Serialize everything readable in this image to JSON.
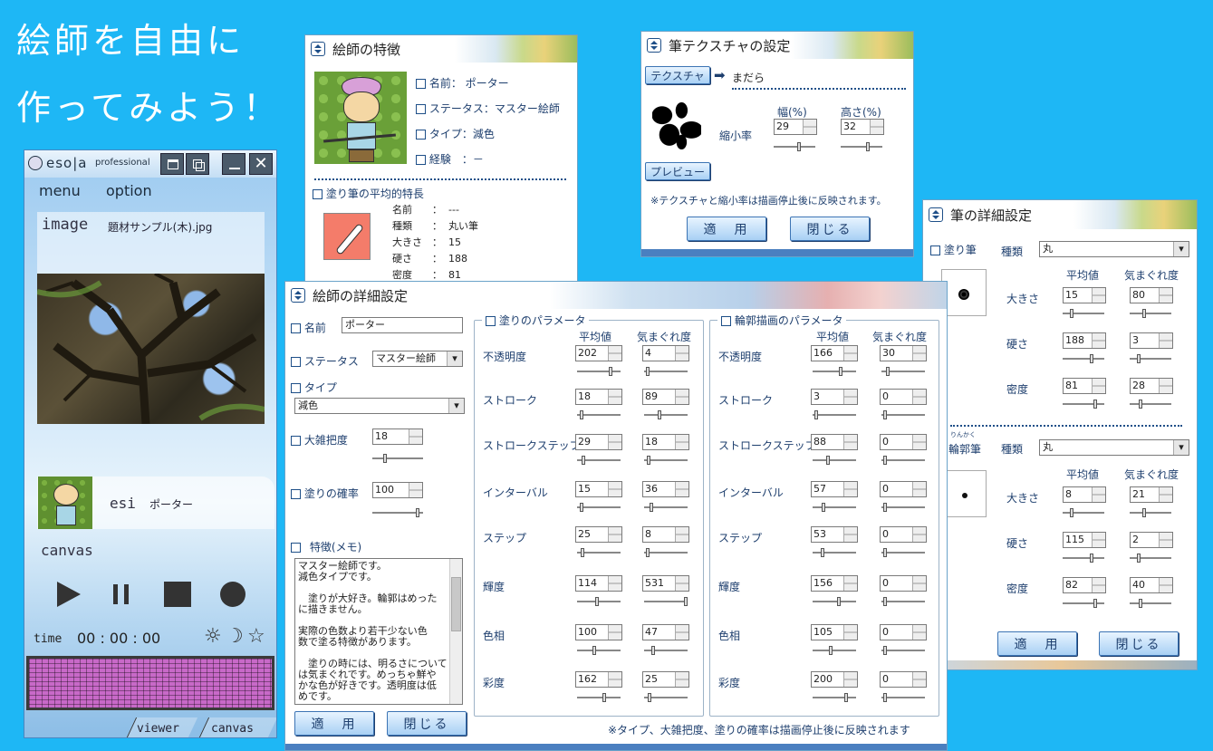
{
  "headline": {
    "line1": "絵師を自由に",
    "line2": "作ってみよう！"
  },
  "esola": {
    "logo": "eso|a",
    "edition": "professional",
    "menu": [
      "menu",
      "option"
    ],
    "image_label": "image",
    "image_file": "題材サンプル(木).jpg",
    "esi_label": "esi",
    "esi_name": "ポーター",
    "canvas_label": "canvas",
    "time_label": "time",
    "time_value": "00 : 00 : 00",
    "tabs": [
      "viewer",
      "canvas"
    ],
    "level_percent": 100
  },
  "features": {
    "title": "絵師の特徴",
    "name": "名前： ポーター",
    "status": "ステータス：マスター絵師",
    "type": "タイプ：減色",
    "experience": "経験　：－",
    "brush_section": "塗り筆の平均的特長",
    "brush_rows": [
      {
        "k": "名前",
        "v": "---"
      },
      {
        "k": "種類",
        "v": "丸い筆"
      },
      {
        "k": "大きさ",
        "v": "15"
      },
      {
        "k": "硬さ",
        "v": "188"
      },
      {
        "k": "密度",
        "v": "81"
      }
    ]
  },
  "texture": {
    "title": "筆テクスチャの設定",
    "texture_button": "テクスチャ",
    "texture_name": "まだら",
    "width_label": "幅(%)",
    "height_label": "高さ(%)",
    "scale_label": "縮小率",
    "width_value": "29",
    "height_value": "32",
    "preview_button": "プレビュー",
    "note": "※テクスチャと縮小率は描画停止後に反映されます。",
    "apply": "適　用",
    "close": "閉じる"
  },
  "brush_detail": {
    "title": "筆の詳細設定",
    "paint_label": "塗り筆",
    "kind_label": "種類",
    "paint_kind": "丸",
    "avg_label": "平均値",
    "var_label": "気まぐれ度",
    "paint_rows": [
      {
        "label": "大きさ",
        "avg": "15",
        "var": "80"
      },
      {
        "label": "硬さ",
        "avg": "188",
        "var": "3"
      },
      {
        "label": "密度",
        "avg": "81",
        "var": "28"
      }
    ],
    "ruby": "りんかく",
    "outline_label": "輪郭筆",
    "outline_kind": "丸",
    "outline_rows": [
      {
        "label": "大きさ",
        "avg": "8",
        "var": "21"
      },
      {
        "label": "硬さ",
        "avg": "115",
        "var": "2"
      },
      {
        "label": "密度",
        "avg": "82",
        "var": "40"
      }
    ],
    "apply": "適　用",
    "close": "閉じる"
  },
  "detail": {
    "title": "絵師の詳細設定",
    "name_label": "名前",
    "name_value": "ポーター",
    "status_label": "ステータス",
    "status_value": "マスター絵師",
    "type_label": "タイプ",
    "type_value": "減色",
    "roughness_label": "大雑把度",
    "roughness_value": "18",
    "paint_prob_label": "塗りの確率",
    "paint_prob_value": "100",
    "memo_label": "特徴(メモ)",
    "memo_lines": [
      "マスター絵師です。",
      "減色タイプです。",
      "",
      "　塗りが大好き。輪郭はめった",
      "に描きません。",
      "",
      "実際の色数より若干少ない色",
      "数で塗る特徴があります。",
      "",
      "　塗りの時には、明るさについて",
      "は気まぐれです。めっちゃ鮮や",
      "かな色が好きです。透明度は低",
      "めです。"
    ],
    "paint_params_title": "塗りのパラメータ",
    "outline_params_title": "輪郭描画のパラメータ",
    "avg_label": "平均値",
    "var_label": "気まぐれ度",
    "paint_params": [
      {
        "label": "不透明度",
        "avg": "202",
        "var": "4"
      },
      {
        "label": "ストローク",
        "avg": "18",
        "var": "89"
      },
      {
        "label": "ストロークステップ",
        "avg": "29",
        "var": "18"
      },
      {
        "label": "インターバル",
        "avg": "15",
        "var": "36"
      },
      {
        "label": "ステップ",
        "avg": "25",
        "var": "8"
      },
      {
        "label": "輝度",
        "avg": "114",
        "var": "531"
      },
      {
        "label": "色相",
        "avg": "100",
        "var": "47"
      },
      {
        "label": "彩度",
        "avg": "162",
        "var": "25"
      }
    ],
    "outline_params": [
      {
        "label": "不透明度",
        "avg": "166",
        "var": "30"
      },
      {
        "label": "ストローク",
        "avg": "3",
        "var": "0"
      },
      {
        "label": "ストロークステップ",
        "avg": "88",
        "var": "0"
      },
      {
        "label": "インターバル",
        "avg": "57",
        "var": "0"
      },
      {
        "label": "ステップ",
        "avg": "53",
        "var": "0"
      },
      {
        "label": "輝度",
        "avg": "156",
        "var": "0"
      },
      {
        "label": "色相",
        "avg": "105",
        "var": "0"
      },
      {
        "label": "彩度",
        "avg": "200",
        "var": "0"
      }
    ],
    "apply": "適　用",
    "close": "閉じる",
    "note": "※タイプ、大雑把度、塗りの確率は描画停止後に反映されます"
  }
}
